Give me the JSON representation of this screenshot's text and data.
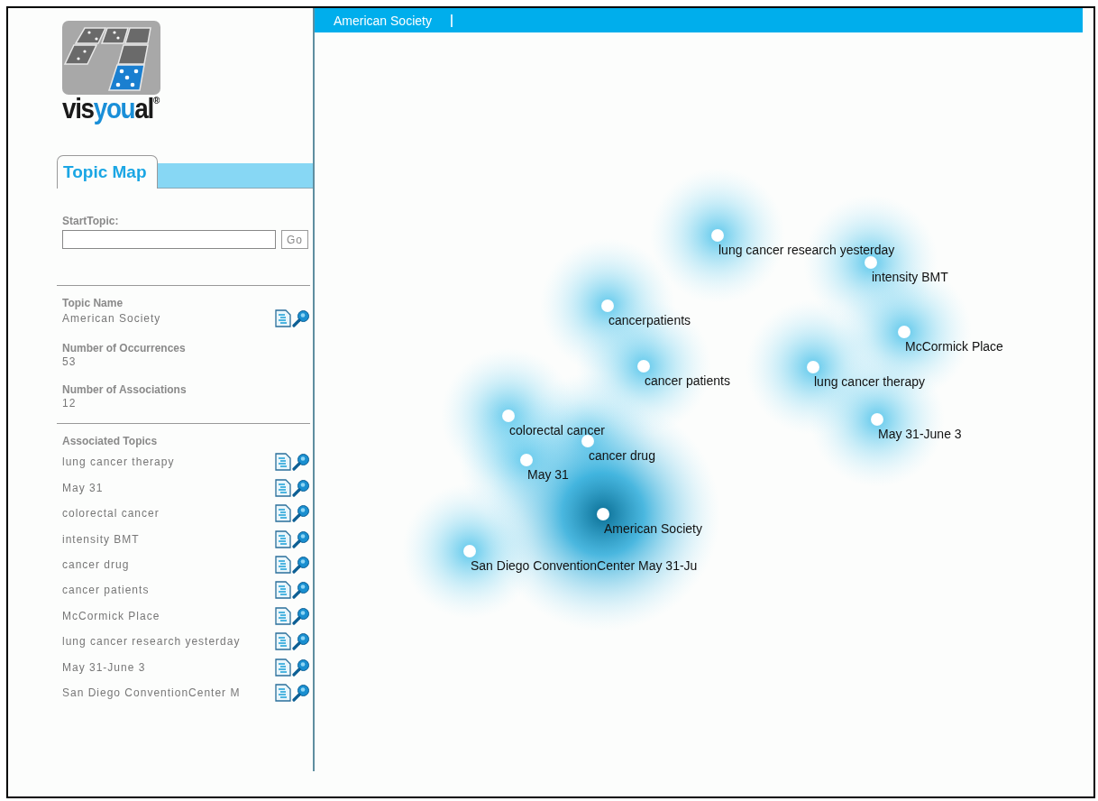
{
  "logo": {
    "parts": [
      {
        "text": "vis",
        "accent": false
      },
      {
        "text": "you",
        "accent": true
      },
      {
        "text": "al",
        "accent": false
      }
    ],
    "mark": "®"
  },
  "tabs": [
    {
      "label": "Topic Map",
      "selected": true
    }
  ],
  "start_topic": {
    "label": "StartTopic:",
    "button": "Go"
  },
  "topic": {
    "name_label": "Topic Name",
    "name": "American Society",
    "occurrences_label": "Number of Occurrences",
    "occurrences": "53",
    "associations_label": "Number of Associations",
    "associations": "12"
  },
  "associated": {
    "label": "Associated Topics",
    "items": [
      {
        "name": "lung cancer therapy"
      },
      {
        "name": "May 31"
      },
      {
        "name": "colorectal cancer"
      },
      {
        "name": "intensity BMT"
      },
      {
        "name": "cancer drug"
      },
      {
        "name": "cancer patients"
      },
      {
        "name": "McCormick Place"
      },
      {
        "name": "lung cancer research yesterday"
      },
      {
        "name": "May 31-June 3"
      },
      {
        "name": "San Diego ConventionCenter M"
      }
    ]
  },
  "breadcrumb": [
    "American Society"
  ],
  "map": {
    "nodes": [
      {
        "label": "lung cancer research yesterday",
        "central": false
      },
      {
        "label": "intensity BMT",
        "central": false
      },
      {
        "label": "cancerpatients",
        "central": false
      },
      {
        "label": "McCormick Place",
        "central": false
      },
      {
        "label": "cancer patients",
        "central": false
      },
      {
        "label": "lung cancer therapy",
        "central": false
      },
      {
        "label": "colorectal cancer",
        "central": false
      },
      {
        "label": "May 31-June 3",
        "central": false
      },
      {
        "label": "cancer drug",
        "central": false
      },
      {
        "label": "May 31",
        "central": false
      },
      {
        "label": "American Society",
        "central": true
      },
      {
        "label": "San Diego ConventionCenter May 31-Ju",
        "central": false
      }
    ]
  }
}
